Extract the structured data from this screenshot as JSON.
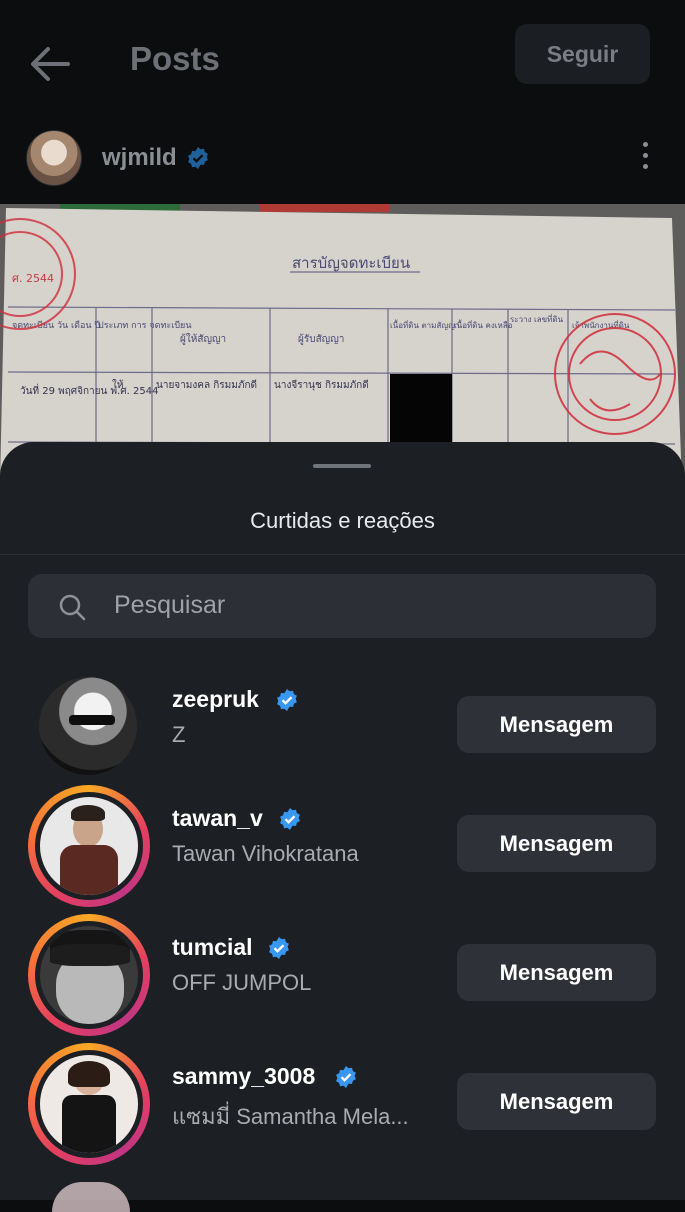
{
  "header": {
    "title": "Posts",
    "follow_label": "Seguir"
  },
  "post": {
    "username": "wjmild"
  },
  "document": {
    "heading": "สารบัญจดทะเบียน",
    "stamp_text": "ศ. 2544",
    "columns": [
      "จดทะเบียน วัน เดือน ปี",
      "ประเภท การ จดทะเบียน",
      "ผู้ให้สัญญา",
      "ผู้รับสัญญา",
      "เนื้อที่ดิน ตามสัญญา",
      "เนื้อที่ดิน คงเหลือ",
      "ระวาง เลขที่ดิน",
      "เจ้าพนักงานที่ดิน"
    ],
    "row": [
      "วันที่ 29 พฤศจิกายน พ.ศ. 2544",
      "ให้",
      "นายจามงคล กิรมมภักดี",
      "นางจีรานุช กิรมมภักดี"
    ]
  },
  "sheet": {
    "title": "Curtidas e reações",
    "search_placeholder": "Pesquisar"
  },
  "users": [
    {
      "username": "zeepruk",
      "fullname": "Z",
      "button": "Mensagem",
      "story_ring": false
    },
    {
      "username": "tawan_v",
      "fullname": "Tawan Vihokratana",
      "button": "Mensagem",
      "story_ring": true
    },
    {
      "username": "tumcial",
      "fullname": "OFF JUMPOL",
      "button": "Mensagem",
      "story_ring": true
    },
    {
      "username": "sammy_3008",
      "fullname": "แซมมี่ Samantha Mela...",
      "button": "Mensagem",
      "story_ring": true
    }
  ],
  "colors": {
    "verified": "#3897f0",
    "sheet_bg": "#1c1f23",
    "button_bg": "#2e3238"
  }
}
